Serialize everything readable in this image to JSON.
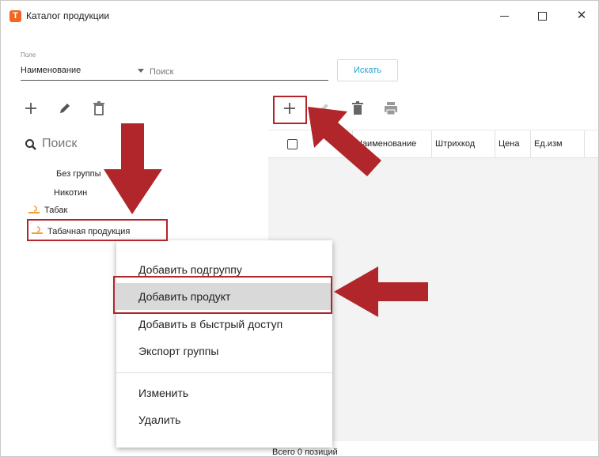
{
  "window": {
    "app_icon_letter": "T",
    "title": "Каталог продукции",
    "minimize": "",
    "maximize": "",
    "close": "✕"
  },
  "filter": {
    "field_caption": "Поле",
    "field_value": "Наименование",
    "search_placeholder": "Поиск",
    "find_button": "Искать"
  },
  "left_panel": {
    "search_label": "Поиск",
    "tree": [
      {
        "label": "Без группы"
      },
      {
        "label": "Никотин"
      },
      {
        "label": "Табак"
      },
      {
        "label": "Табачная продукция"
      }
    ]
  },
  "table": {
    "columns": [
      "Наименование",
      "Штрихкод",
      "Цена",
      "Ед.изм"
    ],
    "status": "Всего 0 позиций"
  },
  "context_menu": {
    "items": [
      {
        "label": "Добавить подгруппу"
      },
      {
        "label": "Добавить продукт"
      },
      {
        "label": "Добавить в быстрый доступ"
      },
      {
        "label": "Экспорт группы"
      },
      {
        "label": "Изменить"
      },
      {
        "label": "Удалить"
      }
    ],
    "selected_index": 1
  },
  "colors": {
    "accent": "#f26522",
    "link_blue": "#2aa1d3",
    "annotation_red": "#b0262b",
    "folder_orange": "#f0a030"
  }
}
